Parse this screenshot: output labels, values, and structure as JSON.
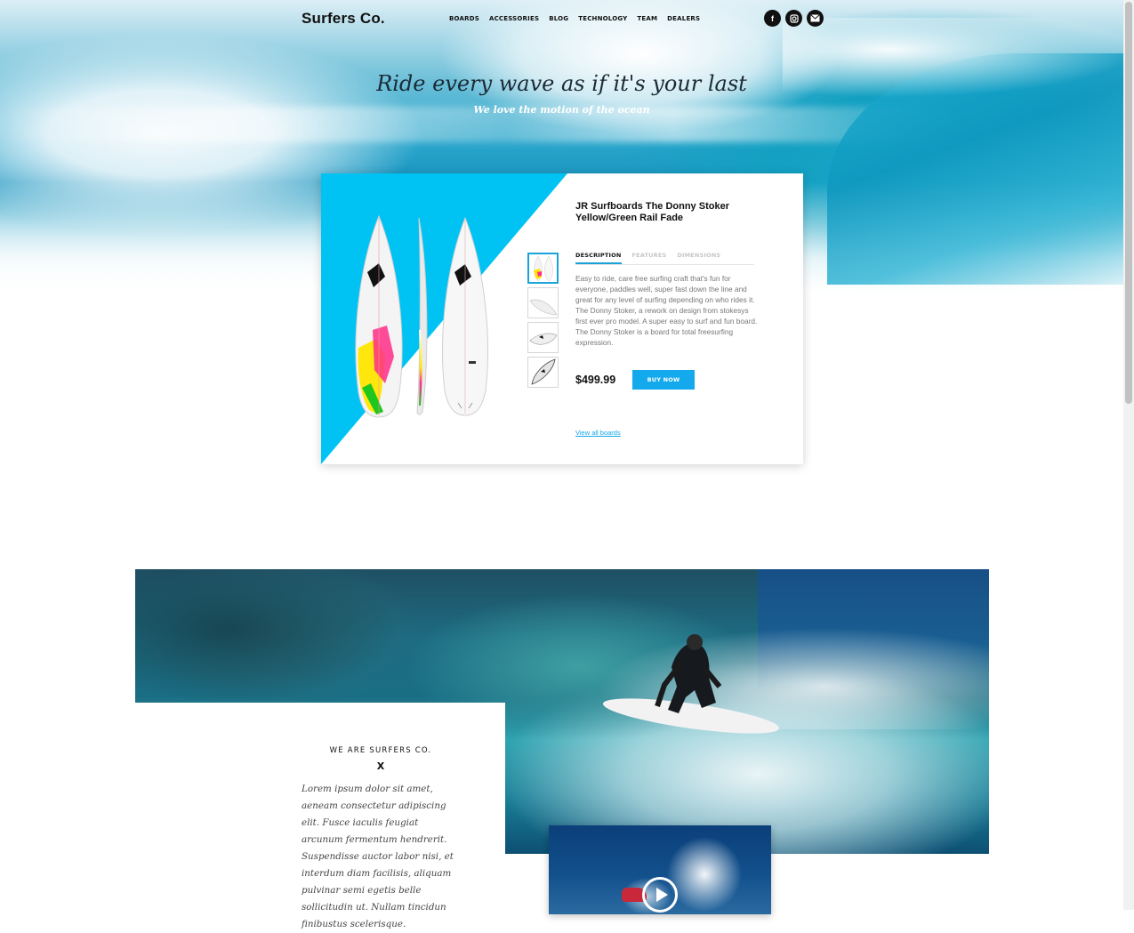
{
  "header": {
    "logo": "Surfers Co.",
    "nav": [
      "BOARDS",
      "ACCESSORIES",
      "BLOG",
      "TECHNOLOGY",
      "TEAM",
      "DEALERS"
    ],
    "social": [
      {
        "icon": "facebook-icon",
        "glyph": "f"
      },
      {
        "icon": "instagram-icon",
        "glyph": "◙"
      },
      {
        "icon": "mail-icon",
        "glyph": "✉"
      }
    ]
  },
  "hero": {
    "title": "Ride every wave as if it's your last",
    "subtitle": "We love the motion of the ocean"
  },
  "product": {
    "name": "JR Surfboards The Donny Stoker Yellow/Green Rail Fade",
    "tabs": [
      "DESCRIPTION",
      "FEATURES",
      "DIMENSIONS"
    ],
    "active_tab": "DESCRIPTION",
    "description": "Easy to ride, care free surfing craft that's fun for everyone, paddles well, super fast down the line and great for any level of surfing depending on who rides it. The Donny Stoker, a rework on design from stokesys first ever pro model. A super easy to surf and fun board. The Donny Stoker is a board for total freesurfing expression.",
    "price": "$499.99",
    "buy_label": "BUY NOW",
    "view_all": "View all boards",
    "accent_color": "#00c3f4"
  },
  "about": {
    "title": "WE ARE SURFERS CO.",
    "divider": "X",
    "text": "Lorem ipsum dolor sit amet, aeneam consectetur adipiscing elit. Fusce iaculis feugiat arcunum fermentum hendrerit. Suspendisse auctor labor nisi, et interdum diam facilisis, aliquam pulvinar semi egetis belle sollicitudin ut. Nullam tincidun finibustus scelerisque."
  }
}
